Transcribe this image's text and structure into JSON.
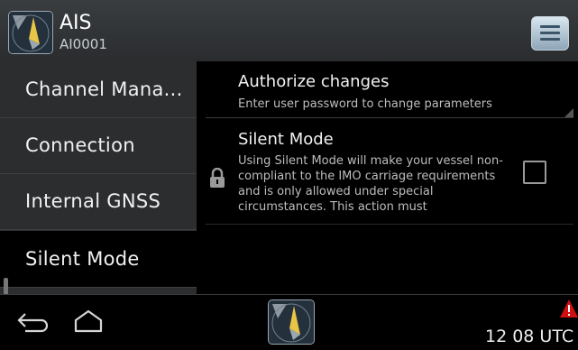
{
  "header": {
    "title": "AIS",
    "subtitle": "AI0001",
    "app_icon": "ais-compass-icon",
    "menu_icon": "menu-list-icon"
  },
  "sidebar": {
    "items": [
      {
        "label": "Channel Mana..."
      },
      {
        "label": "Connection"
      },
      {
        "label": "Internal GNSS"
      },
      {
        "label": "Silent Mode"
      }
    ],
    "active_index": 3
  },
  "settings": {
    "authorize": {
      "title": "Authorize changes",
      "description": "Enter user password to change parameters"
    },
    "silent_mode": {
      "title": "Silent Mode",
      "description": "Using Silent Mode will make your vessel non-compliant to the IMO carriage requirements and is only allowed under special circumstances. This action must",
      "checked": false,
      "locked_icon": "lock-icon"
    }
  },
  "navbar": {
    "back_icon": "back-icon",
    "home_icon": "home-icon",
    "center_icon": "ais-compass-icon",
    "alert_icon": "warning-icon",
    "time": "12 08 UTC"
  },
  "colors": {
    "alert": "#d01010",
    "topbar": "#33363a",
    "sidebar": "#2c2d2f"
  }
}
